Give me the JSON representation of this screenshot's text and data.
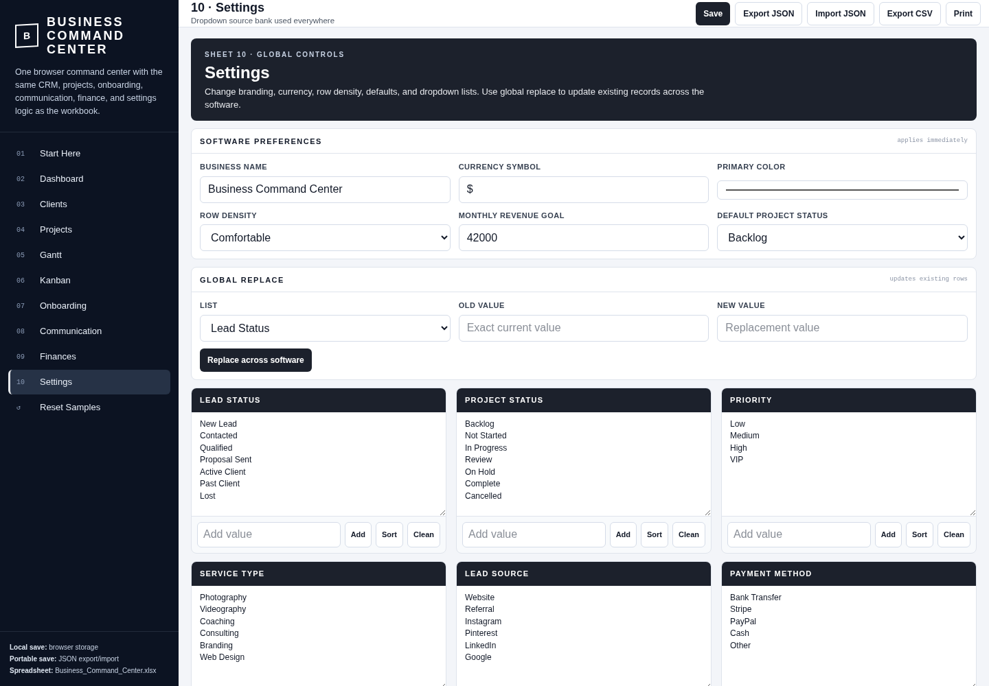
{
  "brand": {
    "logo_letter": "B",
    "title_lines": [
      "BUSINESS",
      "COMMAND",
      "CENTER"
    ],
    "description": "One browser command center with the same CRM, projects, onboarding, communication, finance, and settings logic as the workbook."
  },
  "sidebar": {
    "items": [
      {
        "number": "01",
        "label": "Start Here",
        "selected": false
      },
      {
        "number": "02",
        "label": "Dashboard",
        "selected": false
      },
      {
        "number": "03",
        "label": "Clients",
        "selected": false
      },
      {
        "number": "04",
        "label": "Projects",
        "selected": false
      },
      {
        "number": "05",
        "label": "Gantt",
        "selected": false
      },
      {
        "number": "06",
        "label": "Kanban",
        "selected": false
      },
      {
        "number": "07",
        "label": "Onboarding",
        "selected": false
      },
      {
        "number": "08",
        "label": "Communication",
        "selected": false
      },
      {
        "number": "09",
        "label": "Finances",
        "selected": false
      },
      {
        "number": "10",
        "label": "Settings",
        "selected": true
      },
      {
        "number": "↺",
        "label": "Reset Samples",
        "selected": false
      }
    ],
    "footer": [
      "**Local save:** browser storage",
      "**Portable save:** JSON export/import",
      "**Spreadsheet:** Business_Command_Center.xlsx"
    ]
  },
  "topbar": {
    "title": "10 · Settings",
    "subtitle": "Dropdown source bank used everywhere",
    "buttons": [
      {
        "label": "Save",
        "primary": true
      },
      {
        "label": "Export JSON",
        "primary": false
      },
      {
        "label": "Import JSON",
        "primary": false
      },
      {
        "label": "Export CSV",
        "primary": false
      },
      {
        "label": "Print",
        "primary": false
      }
    ]
  },
  "hero": {
    "eyebrow": "SHEET 10 · GLOBAL CONTROLS",
    "title": "Settings",
    "text": "Change branding, currency, row density, defaults, and dropdown lists. Use global replace to update existing records across the software."
  },
  "preferences": {
    "title": "SOFTWARE PREFERENCES",
    "note": "applies immediately",
    "fields": [
      {
        "label": "BUSINESS NAME",
        "kind": "text",
        "value": "Business Command Center"
      },
      {
        "label": "CURRENCY SYMBOL",
        "kind": "text",
        "value": "$"
      },
      {
        "label": "PRIMARY COLOR",
        "kind": "color",
        "color": "#555555"
      },
      {
        "label": "ROW DENSITY",
        "kind": "select",
        "value": "Comfortable"
      },
      {
        "label": "MONTHLY REVENUE GOAL",
        "kind": "text",
        "value": "42000"
      },
      {
        "label": "DEFAULT PROJECT STATUS",
        "kind": "select",
        "value": "Backlog"
      }
    ]
  },
  "global_replace": {
    "title": "GLOBAL REPLACE",
    "note": "updates existing rows",
    "fields": [
      {
        "label": "LIST",
        "kind": "select",
        "value": "Lead Status"
      },
      {
        "label": "OLD VALUE",
        "kind": "text",
        "placeholder": "Exact current value"
      },
      {
        "label": "NEW VALUE",
        "kind": "text",
        "placeholder": "Replacement value"
      }
    ],
    "button": "Replace across software"
  },
  "lists": [
    {
      "title": "LEAD STATUS",
      "values": [
        "New Lead",
        "Contacted",
        "Qualified",
        "Proposal Sent",
        "Active Client",
        "Past Client",
        "Lost"
      ],
      "placeholder": "Add value",
      "buttons": [
        "Add",
        "Sort",
        "Clean"
      ]
    },
    {
      "title": "PROJECT STATUS",
      "values": [
        "Backlog",
        "Not Started",
        "In Progress",
        "Review",
        "On Hold",
        "Complete",
        "Cancelled"
      ],
      "placeholder": "Add value",
      "buttons": [
        "Add",
        "Sort",
        "Clean"
      ]
    },
    {
      "title": "PRIORITY",
      "values": [
        "Low",
        "Medium",
        "High",
        "VIP"
      ],
      "placeholder": "Add value",
      "buttons": [
        "Add",
        "Sort",
        "Clean"
      ]
    },
    {
      "title": "SERVICE TYPE",
      "values": [
        "Photography",
        "Videography",
        "Coaching",
        "Consulting",
        "Branding",
        "Web Design"
      ]
    },
    {
      "title": "LEAD SOURCE",
      "values": [
        "Website",
        "Referral",
        "Instagram",
        "Pinterest",
        "LinkedIn",
        "Google"
      ]
    },
    {
      "title": "PAYMENT METHOD",
      "values": [
        "Bank Transfer",
        "Stripe",
        "PayPal",
        "Cash",
        "Other"
      ]
    }
  ]
}
